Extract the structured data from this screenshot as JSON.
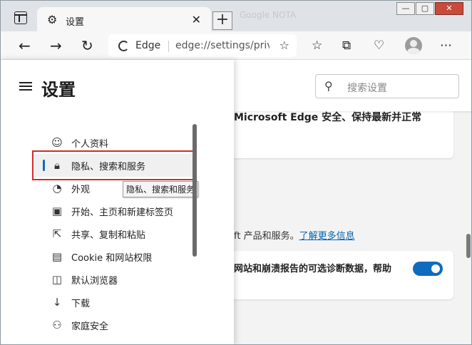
{
  "tab": {
    "title": "设置",
    "close": "✕"
  },
  "newtab": "+",
  "ghost_tabs": "Google   NOTA",
  "window_controls": {
    "minimize": "—",
    "maximize": "▢",
    "close": "✕"
  },
  "address": {
    "brand": "Edge",
    "url": "edge://settings/privacy"
  },
  "search": {
    "placeholder": "搜索设置"
  },
  "sidebar": {
    "title": "设置",
    "items": [
      {
        "label": "个人资料",
        "icon": "profile-icon"
      },
      {
        "label": "隐私、搜索和服务",
        "icon": "lock-icon",
        "active": true
      },
      {
        "label": "外观",
        "icon": "palette-icon"
      },
      {
        "label": "开始、主页和新建标签页",
        "icon": "home-grid-icon"
      },
      {
        "label": "共享、复制和粘贴",
        "icon": "share-icon"
      },
      {
        "label": "Cookie 和网站权限",
        "icon": "site-permissions-icon"
      },
      {
        "label": "默认浏览器",
        "icon": "browser-icon"
      },
      {
        "label": "下载",
        "icon": "download-icon"
      },
      {
        "label": "家庭安全",
        "icon": "family-icon"
      }
    ],
    "tooltip": "隐私、搜索和服务"
  },
  "content": {
    "card1_text": "Microsoft Edge 安全、保持最新并正常",
    "info_text": "ft 产品和服务。",
    "info_link": "了解更多信息",
    "card2_text": "网站和崩溃报告的可选诊断数据，帮助",
    "toggle_on": true
  },
  "colors": {
    "accent": "#0f6cbd",
    "highlight_box": "#d12a2a",
    "link": "#0066b4"
  }
}
